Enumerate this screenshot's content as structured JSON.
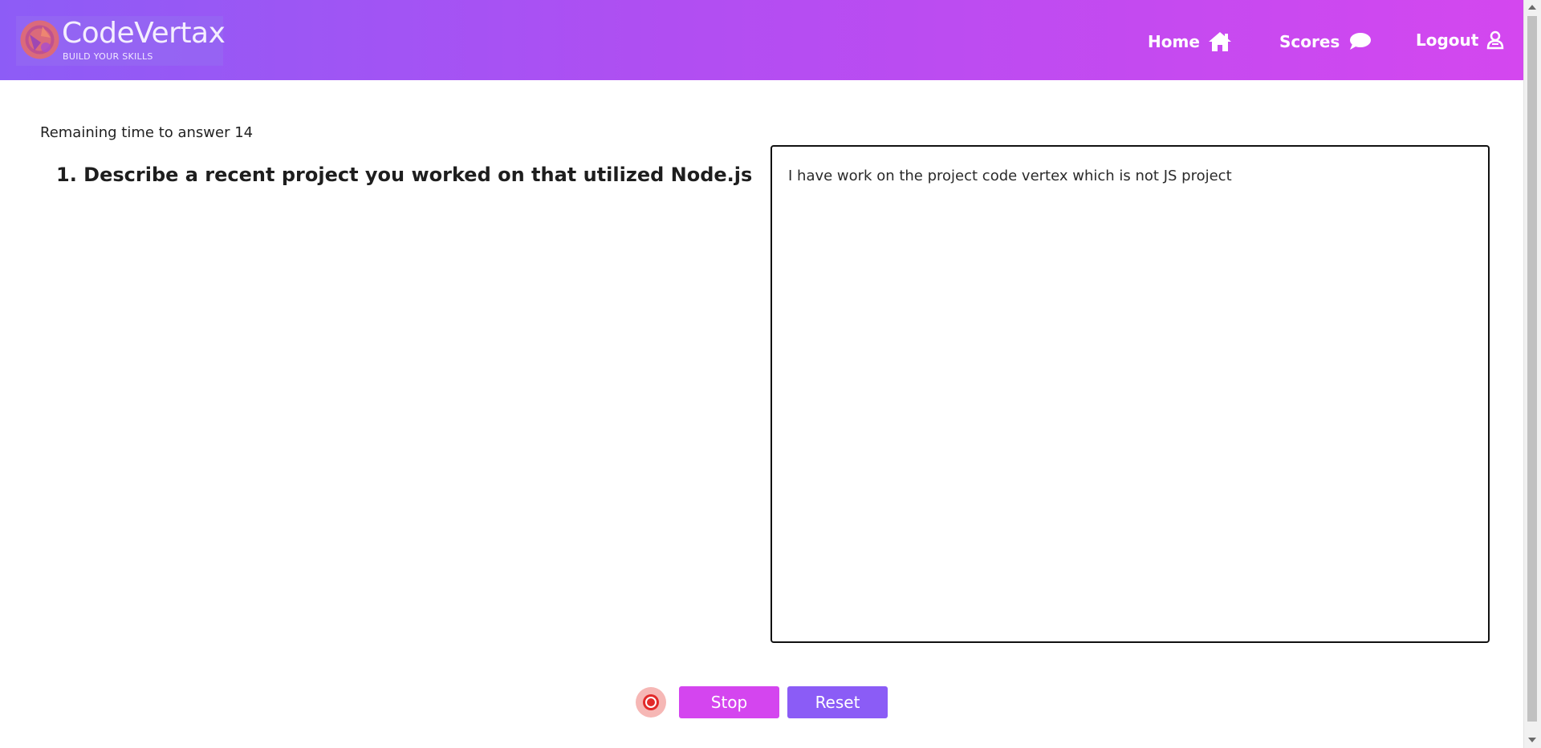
{
  "brand": {
    "name": "CodeVertax",
    "tagline": "BUILD YOUR SKILLS"
  },
  "nav": {
    "items": [
      {
        "label": "Home",
        "icon": "home-icon"
      },
      {
        "label": "Scores",
        "icon": "chat-bubble-icon"
      },
      {
        "label": "Logout",
        "icon": "user-icon"
      }
    ]
  },
  "quiz": {
    "timer_text": "Remaining time to answer 14",
    "question": "1. Describe a recent project you worked on that utilized Node.js",
    "answer": "I have work on the project code vertex which is not JS project"
  },
  "controls": {
    "record_icon": "record-icon",
    "stop_label": "Stop",
    "reset_label": "Reset"
  },
  "colors": {
    "header_gradient_start": "#8d5cf6",
    "header_gradient_end": "#d447ef",
    "stop_button": "#d445ef",
    "reset_button": "#8b5cf6",
    "record_button": "#e22a2a"
  }
}
